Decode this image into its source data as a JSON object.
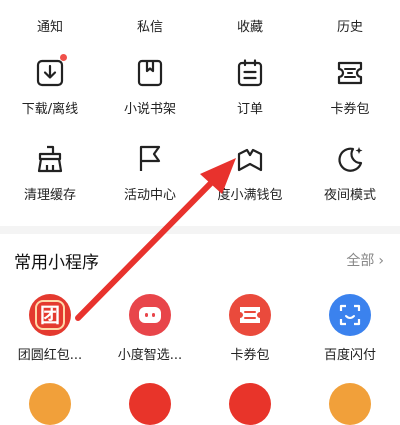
{
  "menu": {
    "row0": [
      "通知",
      "私信",
      "收藏",
      "历史"
    ],
    "row1": [
      "下载/离线",
      "小说书架",
      "订单",
      "卡券包"
    ],
    "row2": [
      "清理缓存",
      "活动中心",
      "度小满钱包",
      "夜间模式"
    ]
  },
  "section": {
    "title": "常用小程序",
    "more": "全部",
    "more_icon": "chevron-right-icon"
  },
  "mini_apps": [
    {
      "label": "团圆红包...",
      "icon": "tuan-logo-icon",
      "color": "#e43a2f",
      "glyph": "团"
    },
    {
      "label": "小度智选...",
      "icon": "xiaodu-icon",
      "color": "#e8454a"
    },
    {
      "label": "卡券包",
      "icon": "ticket-icon",
      "color": "#ea4a3c"
    },
    {
      "label": "百度闪付",
      "icon": "scan-face-icon",
      "color": "#3b82ee"
    }
  ],
  "colors": {
    "accent_red": "#e8322d",
    "notification_dot": "#f0504a",
    "separator": "#f4f4f4"
  }
}
